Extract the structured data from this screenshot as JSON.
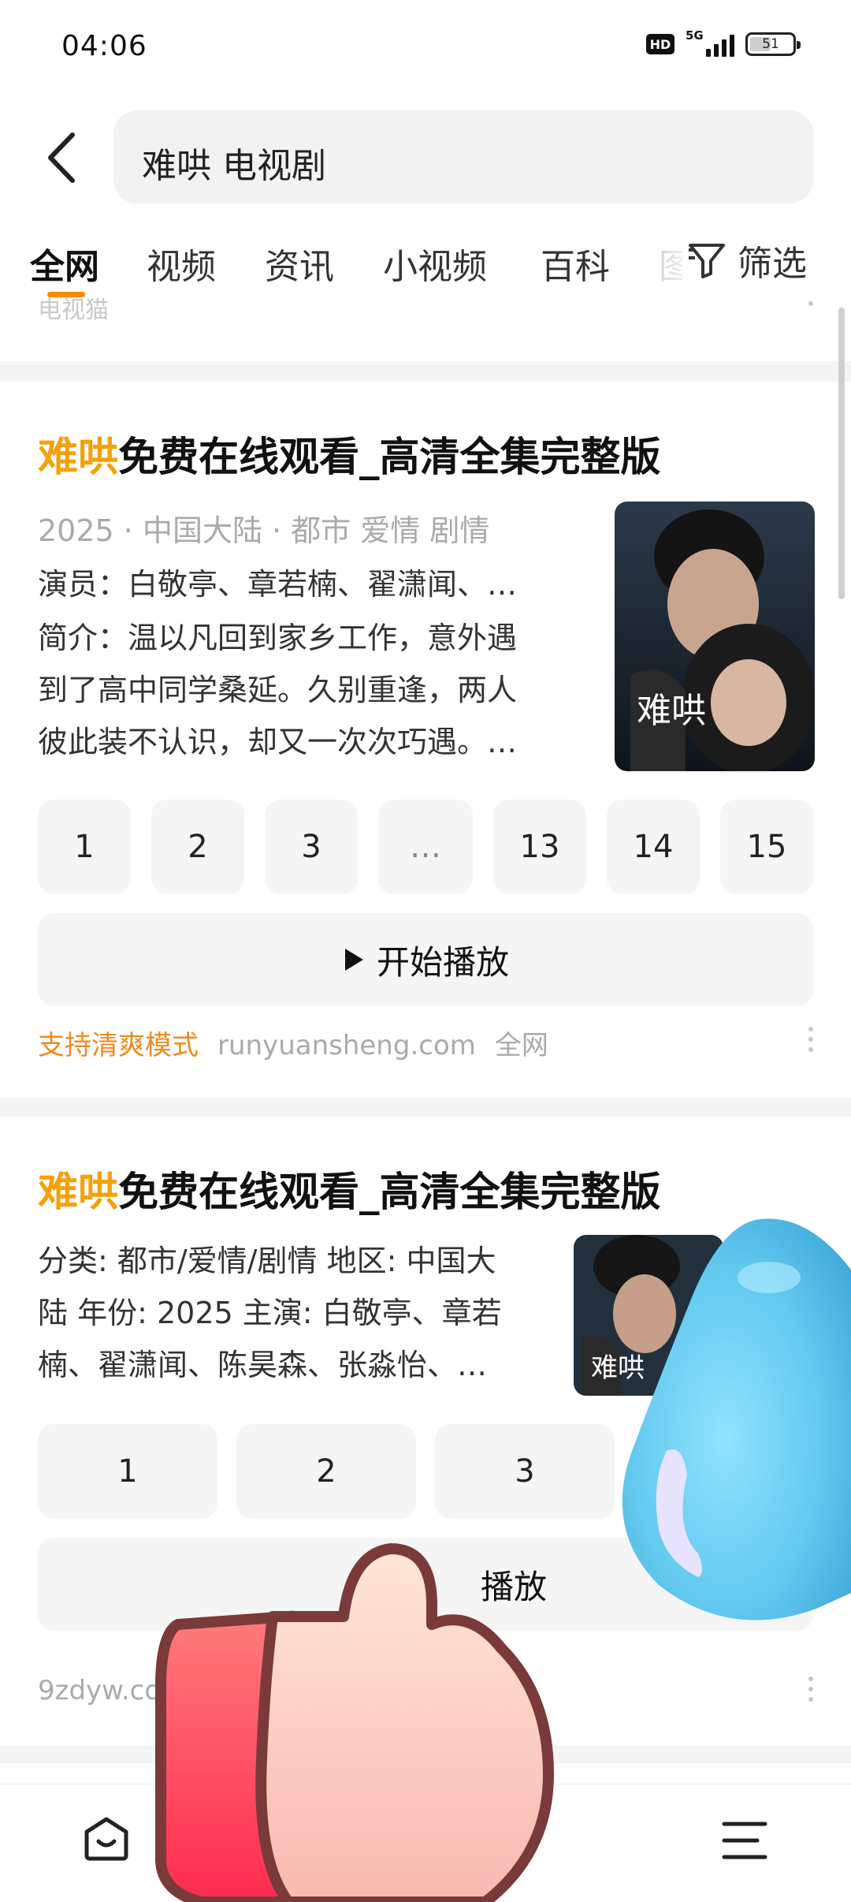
{
  "status": {
    "time": "04:06",
    "hd": "HD",
    "network": "5G",
    "battery": "51",
    "battery_level": 0.51
  },
  "search": {
    "query": "难哄 电视剧"
  },
  "tabs": [
    "全网",
    "视频",
    "资讯",
    "小视频",
    "百科",
    "图"
  ],
  "filter_label": "筛选",
  "ghost_text": "电视猫",
  "result1": {
    "title_highlight": "难哄",
    "title_rest": "免费在线观看_高清全集完整版",
    "meta": "2025 · 中国大陆 · 都市 爱情 剧情",
    "cast": "演员：白敬亭、章若楠、翟潇闻、…",
    "intro_lines": [
      "简介：温以凡回到家乡工作，意外遇",
      "到了高中同学桑延。久别重逢，两人",
      "彼此装不认识，却又一次次巧遇。…"
    ],
    "episodes": [
      "1",
      "2",
      "3",
      "…",
      "13",
      "14",
      "15"
    ],
    "play_label": "开始播放",
    "tag": "支持清爽模式",
    "domain": "runyuansheng.com",
    "scope": "全网"
  },
  "result2": {
    "title_highlight": "难哄",
    "title_rest": "免费在线观看_高清全集完整版",
    "desc_lines": [
      "分类: 都市/爱情/剧情 地区: 中国大",
      "陆 年份: 2025 主演: 白敬亭、章若",
      "楠、翟潇闻、陈昊森、张淼怡、…"
    ],
    "episodes": [
      "1",
      "2",
      "3"
    ],
    "play_label": "播放",
    "domain": "9zdyw.com"
  },
  "colors": {
    "accent": "#f5a10a",
    "tab_indicator": "#ff8a00",
    "tag": "#f08a1c"
  },
  "icons": {
    "back": "chevron-left-icon",
    "filter": "funnel-icon",
    "home": "home-smile-icon",
    "menu": "menu-icon"
  }
}
